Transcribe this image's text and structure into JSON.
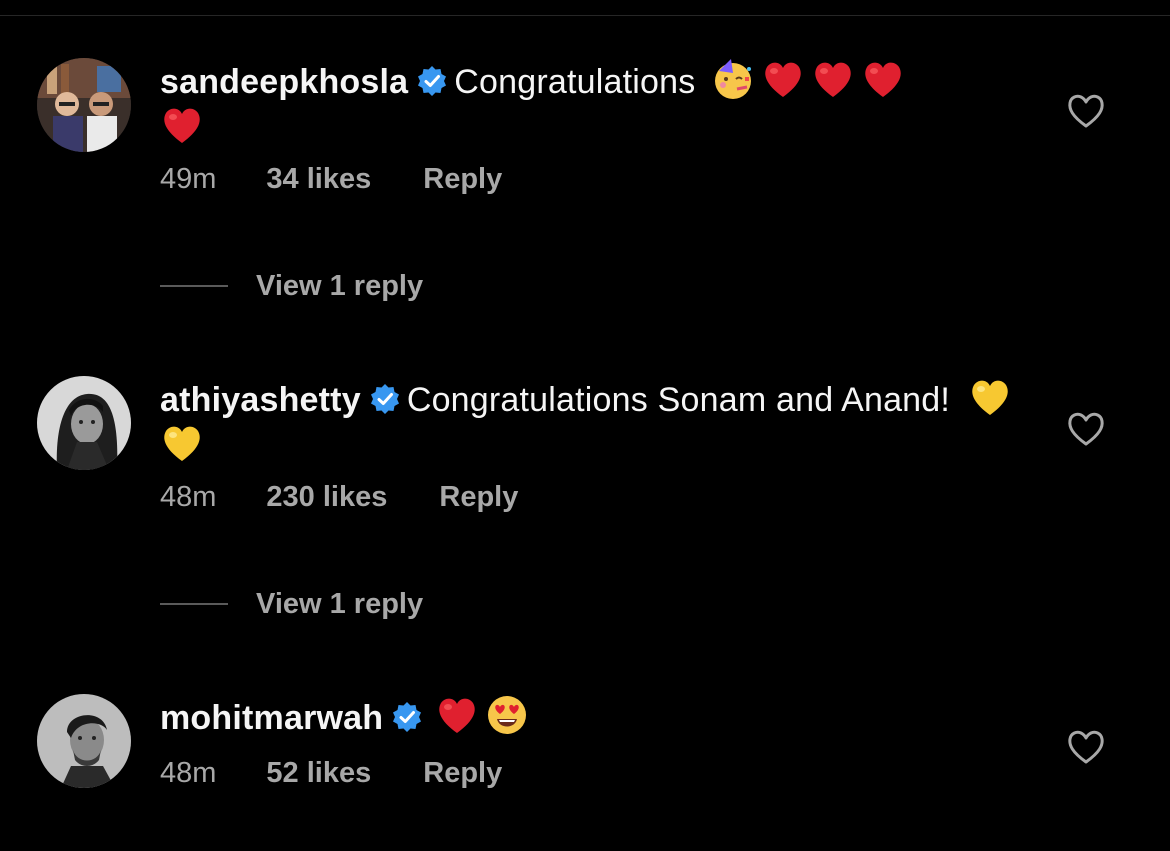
{
  "comments": [
    {
      "username": "sandeepkhosla",
      "verified": true,
      "text": "Congratulations",
      "emojis": [
        "partying-face",
        "red-heart",
        "red-heart",
        "red-heart",
        "red-heart"
      ],
      "time": "49m",
      "likes": "34 likes",
      "reply_label": "Reply",
      "view_replies": "View 1 reply",
      "avatar_icon": "two-men-photo"
    },
    {
      "username": "athiyashetty",
      "verified": true,
      "text": "Congratulations Sonam and Anand!",
      "emojis": [
        "yellow-heart",
        "yellow-heart"
      ],
      "time": "48m",
      "likes": "230 likes",
      "reply_label": "Reply",
      "view_replies": "View 1 reply",
      "avatar_icon": "woman-bw-photo"
    },
    {
      "username": "mohitmarwah",
      "verified": true,
      "text": "",
      "emojis": [
        "red-heart",
        "heart-eyes-face"
      ],
      "time": "48m",
      "likes": "52 likes",
      "reply_label": "Reply",
      "avatar_icon": "man-bw-photo"
    }
  ],
  "colors": {
    "background": "#000000",
    "text": "#f5f5f5",
    "secondary": "#a8a8a8",
    "verified": "#3897f0",
    "red_heart": "#e0202f",
    "yellow_heart": "#f7c831"
  }
}
